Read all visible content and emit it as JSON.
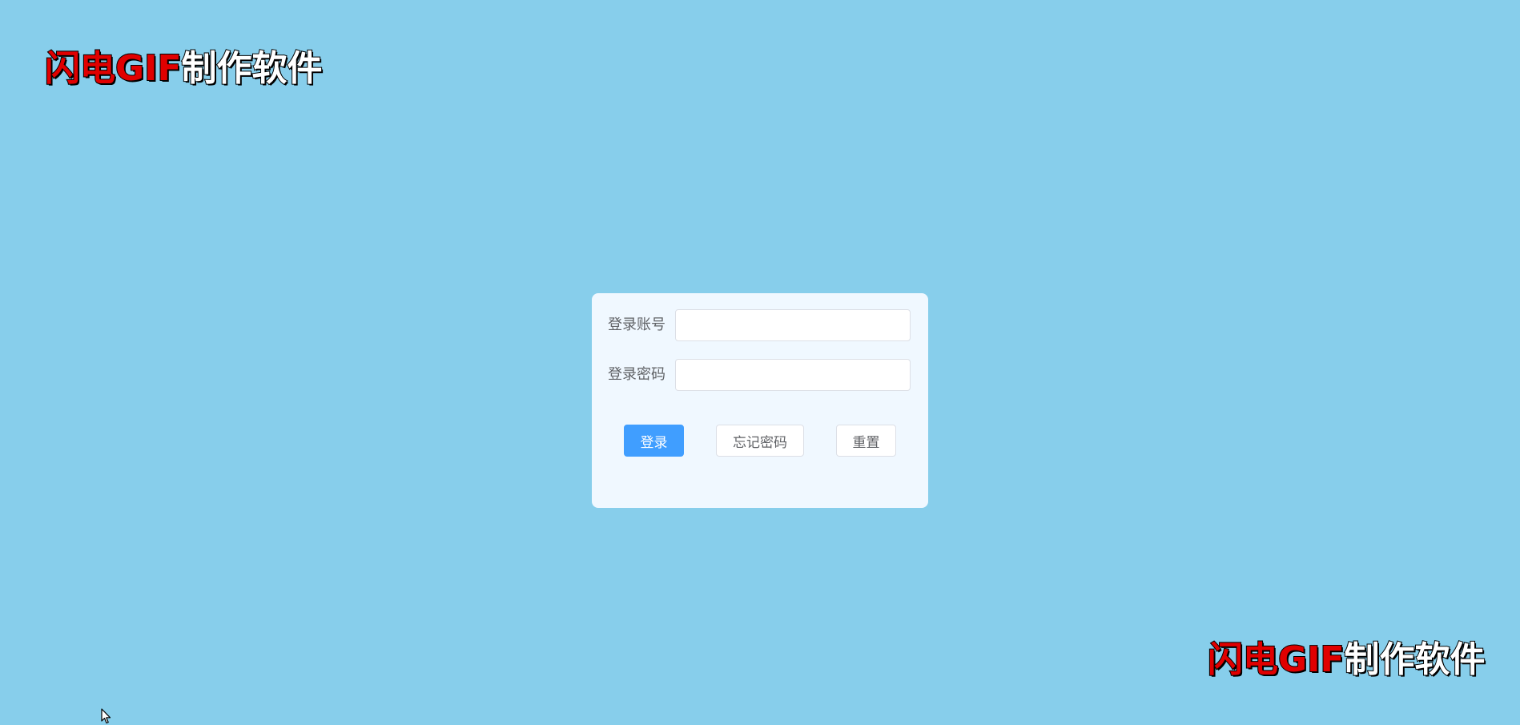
{
  "watermark": {
    "red_part": "闪电GIF",
    "white_part": "制作软件"
  },
  "login": {
    "account_label": "登录账号",
    "account_value": "",
    "password_label": "登录密码",
    "password_value": "",
    "login_button": "登录",
    "forgot_button": "忘记密码",
    "reset_button": "重置"
  },
  "colors": {
    "background": "#87ceeb",
    "card": "#f0f8ff",
    "primary": "#409eff"
  },
  "icons": {
    "cursor": "mouse-pointer-icon"
  }
}
